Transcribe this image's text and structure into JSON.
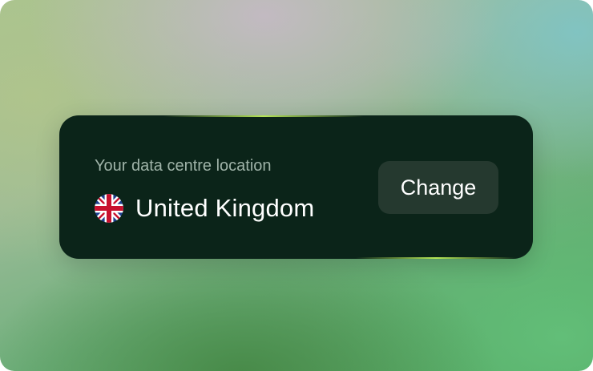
{
  "location_card": {
    "label": "Your data centre location",
    "country": "United Kingdom",
    "flag_icon": "uk-flag-icon",
    "change_label": "Change"
  },
  "colors": {
    "card_background": "#0b2419",
    "button_background": "#25392f",
    "label_text": "#9fb3a8",
    "accent_glow": "#bef05a"
  }
}
